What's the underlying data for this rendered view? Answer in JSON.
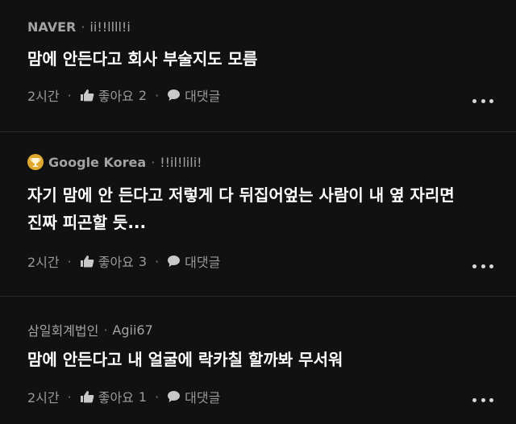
{
  "comments": [
    {
      "author": "NAVER",
      "author_separator": "·",
      "handle": "ii!!llll!i",
      "text_lines": [
        "맘에 안든다고 회사 부술지도 모름"
      ],
      "time": "2시간",
      "like_label": "좋아요",
      "like_count": "2",
      "reply_label": "대댓글",
      "badge": null
    },
    {
      "author": "Google Korea",
      "author_separator": "·",
      "handle": "!!il!lili!",
      "text_lines": [
        "자기 맘에 안 든다고 저렇게 다 뒤집어엎는 사람이 내 옆 자리면",
        "진짜 피곤할 듯..."
      ],
      "time": "2시간",
      "like_label": "좋아요",
      "like_count": "3",
      "reply_label": "대댓글",
      "badge": "trophy-icon"
    },
    {
      "author": "삼일회계법인",
      "author_separator": "·",
      "handle": "Agii67",
      "text_lines": [
        "맘에 안든다고 내 얼굴에 락카칠 할까봐 무서워"
      ],
      "time": "2시간",
      "like_label": "좋아요",
      "like_count": "1",
      "reply_label": "대댓글",
      "badge": null
    }
  ],
  "action_separator": "·",
  "icons": {
    "like": "thumbs-up-icon",
    "reply": "speech-bubble-icon",
    "more": "more-options-icon",
    "badge": "trophy-icon"
  },
  "colors": {
    "background": "#111111",
    "text": "#ffffff",
    "muted": "#a3a3a3",
    "badge": "#e0a82e"
  }
}
